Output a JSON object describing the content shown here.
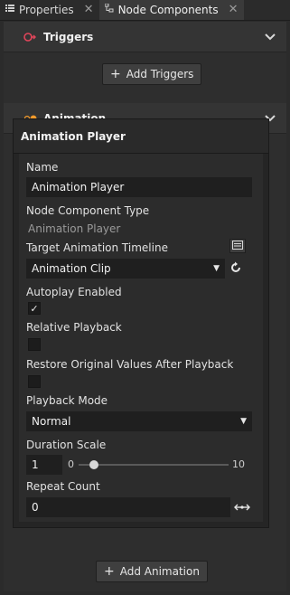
{
  "tabs": [
    {
      "label": "Properties",
      "icon": "list-icon"
    },
    {
      "label": "Node Components",
      "icon": "tree-icon"
    }
  ],
  "triggers": {
    "title": "Triggers",
    "add_label": "Add Triggers"
  },
  "animation": {
    "title": "Animation",
    "add_label": "Add Animation"
  },
  "player": {
    "title": "Animation Player",
    "name_label": "Name",
    "name_value": "Animation Player",
    "type_label": "Node Component Type",
    "type_value": "Animation Player",
    "timeline_label": "Target Animation Timeline",
    "timeline_value": "Animation Clip",
    "autoplay_label": "Autoplay Enabled",
    "autoplay_checked": true,
    "relative_label": "Relative Playback",
    "relative_checked": false,
    "restore_label": "Restore Original Values After Playback",
    "restore_checked": false,
    "mode_label": "Playback Mode",
    "mode_value": "Normal",
    "duration_label": "Duration Scale",
    "duration_value": "1",
    "duration_min": "0",
    "duration_max": "10",
    "duration_fraction": 0.1,
    "repeat_label": "Repeat Count",
    "repeat_value": "0"
  },
  "colors": {
    "trigger_icon": "#e0455a",
    "animation_icon": "#f39a2b"
  }
}
